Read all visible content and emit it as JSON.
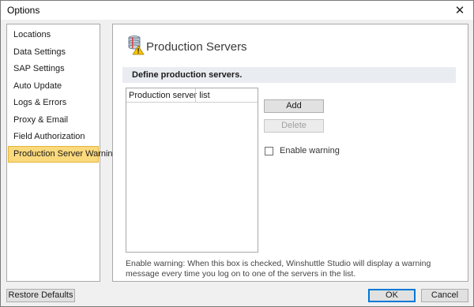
{
  "window": {
    "title": "Options"
  },
  "sidebar": {
    "items": [
      {
        "label": "Locations",
        "active": false
      },
      {
        "label": "Data Settings",
        "active": false
      },
      {
        "label": "SAP Settings",
        "active": false
      },
      {
        "label": "Auto Update",
        "active": false
      },
      {
        "label": "Logs & Errors",
        "active": false
      },
      {
        "label": "Proxy & Email",
        "active": false
      },
      {
        "label": "Field Authorization",
        "active": false
      },
      {
        "label": "Production Server Warning",
        "active": true
      }
    ]
  },
  "main": {
    "icon": "database-warning-icon",
    "title": "Production Servers",
    "section_title": "Define production servers.",
    "list": {
      "column_header": "Production server list",
      "rows": []
    },
    "add_label": "Add",
    "delete_label": "Delete",
    "enable_warning_label": "Enable warning",
    "enable_warning_checked": false,
    "help_text": "Enable warning: When this box is checked, Winshuttle Studio will display a warning message every time you log on to one of the servers in the list."
  },
  "footer": {
    "restore_label": "Restore Defaults",
    "ok_label": "OK",
    "cancel_label": "Cancel"
  },
  "colors": {
    "active_item_bg": "#fbd97d",
    "section_bg": "#e9ecf1",
    "default_button_border": "#0078d7"
  }
}
